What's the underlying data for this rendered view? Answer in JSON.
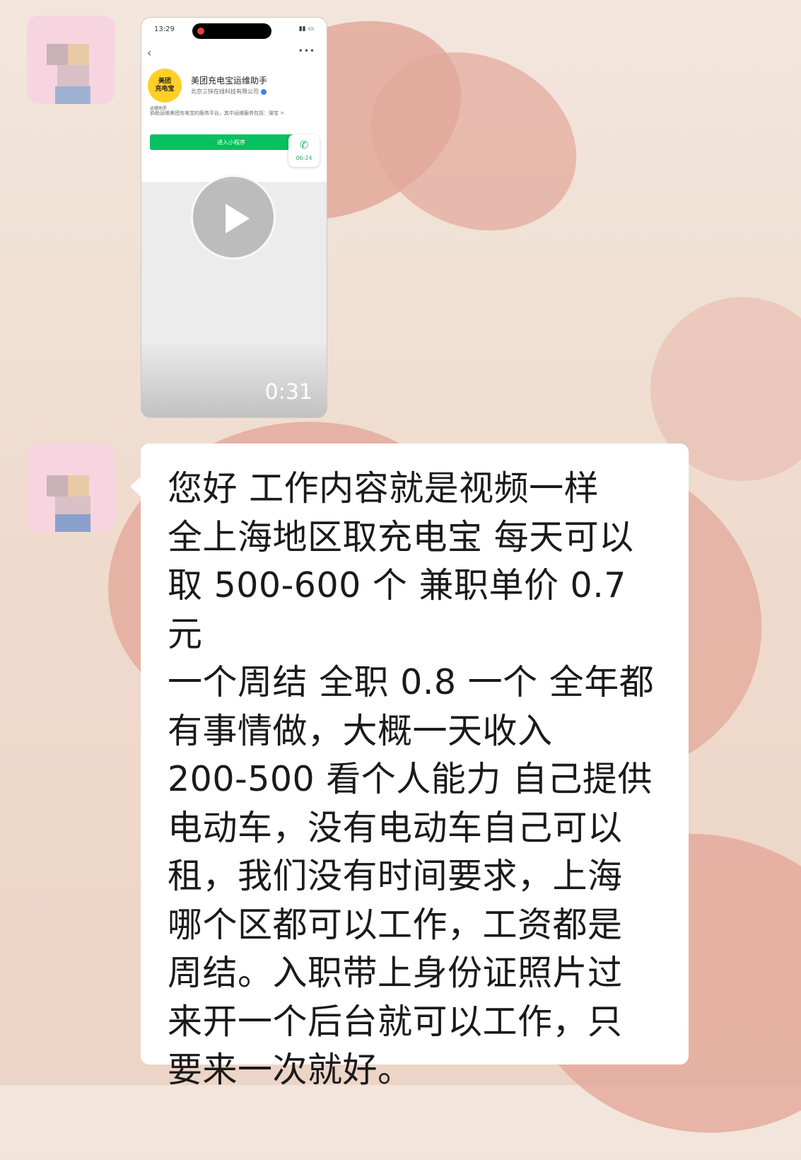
{
  "video_message": {
    "status_time": "13:29",
    "mini_program_name": "美团充电宝运维助手",
    "mini_program_company": "北京三快在线科技有限公司",
    "mini_program_desc": "协助运维美团充电宝的服务平台，其中运维服务包括：弹宝 >",
    "logo_text_line1": "美团",
    "logo_text_line2": "充电宝",
    "logo_caption": "运维助手",
    "enter_button_label": "进入小程序",
    "call_timer": "06:24",
    "duration": "0:31"
  },
  "text_message": {
    "content": "您好 工作内容就是视频一样\n全上海地区取充电宝 每天可以\n取 500-600 个 兼职单价 0.7 元\n一个周结 全职 0.8 一个 全年都\n有事情做，大概一天收入\n200-500 看个人能力 自己提供\n电动车，没有电动车自己可以\n租，我们没有时间要求，上海\n哪个区都可以工作，工资都是\n周结。入职带上身份证照片过\n来开一个后台就可以工作，只\n要来一次就好。"
  },
  "colors": {
    "bubble_bg": "#ffffff",
    "wallpaper_heart": "#e3a89a",
    "wechat_green": "#07c160"
  }
}
